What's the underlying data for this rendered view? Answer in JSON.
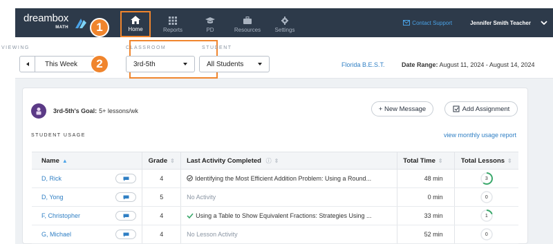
{
  "brand": {
    "name": "dreambox",
    "sub": "MATH"
  },
  "nav": {
    "items": [
      {
        "label": "Home",
        "icon": "home-icon",
        "active": true
      },
      {
        "label": "Reports",
        "icon": "grid-icon"
      },
      {
        "label": "PD",
        "icon": "graduation-cap-icon"
      },
      {
        "label": "Resources",
        "icon": "briefcase-icon"
      },
      {
        "label": "Settings",
        "icon": "gear-icon"
      }
    ],
    "contact": "Contact Support",
    "user": "Jennifer Smith Teacher"
  },
  "steps": [
    "1",
    "2"
  ],
  "filters": {
    "viewing_label": "VIEWING",
    "viewing_value": "This Week",
    "classroom_label": "CLASSROOM",
    "classroom_value": "3rd-5th",
    "student_label": "STUDENT",
    "student_value": "All Students",
    "standards": "Florida B.E.S.T.",
    "date_label": "Date Range:",
    "date_value": "August 11, 2024 - August 14, 2024"
  },
  "card": {
    "goal_title": "3rd-5th's Goal:",
    "goal_value": "5+ lessons/wk",
    "new_message": "+ New Message",
    "add_assignment": "Add Assignment",
    "usage_label": "STUDENT USAGE",
    "monthly_link": "view monthly usage report"
  },
  "table": {
    "headers": {
      "name": "Name",
      "grade": "Grade",
      "activity": "Last Activity Completed",
      "time": "Total Time",
      "lessons": "Total Lessons"
    },
    "rows": [
      {
        "name": "D, Rick",
        "grade": "4",
        "activity": "Identifying the Most Efficient Addition Problem: Using a Round...",
        "activity_icon": "check-circle-icon",
        "time": "48 min",
        "lessons": "3",
        "progress": 0.6
      },
      {
        "name": "D, Yong",
        "grade": "5",
        "activity": "No Activity",
        "activity_icon": "",
        "time": "0 min",
        "lessons": "0",
        "progress": 0
      },
      {
        "name": "F, Christopher",
        "grade": "4",
        "activity": "Using a Table to Show Equivalent Fractions: Strategies Using ...",
        "activity_icon": "check-icon",
        "time": "33 min",
        "lessons": "1",
        "progress": 0.2
      },
      {
        "name": "G, Michael",
        "grade": "4",
        "activity": "No Lesson Activity",
        "activity_icon": "",
        "time": "52 min",
        "lessons": "0",
        "progress": 0
      }
    ]
  },
  "colors": {
    "nav_bg": "#2d3a4a",
    "accent_orange": "#f0852d",
    "link_blue": "#2f7fc4",
    "ring_green": "#3aa86b"
  }
}
